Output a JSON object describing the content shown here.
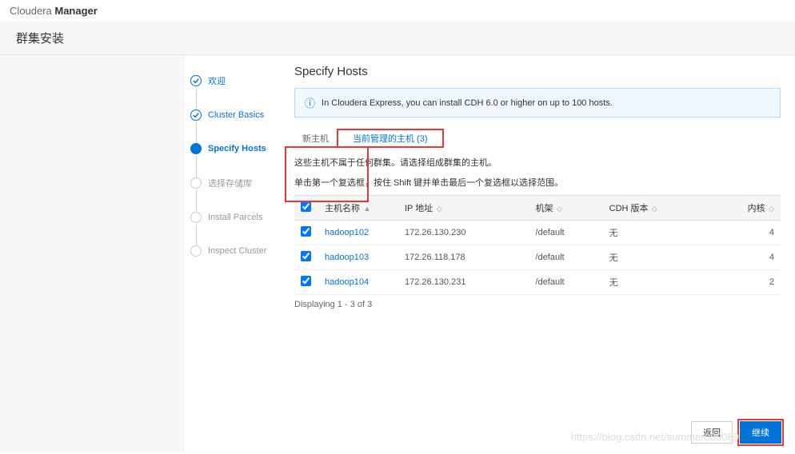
{
  "header": {
    "brand1": "Cloudera ",
    "brand2": "Manager"
  },
  "subheader": "群集安装",
  "wizard": {
    "steps": [
      "欢迎",
      "Cluster Basics",
      "Specify Hosts",
      "选择存储库",
      "Install Parcels",
      "Inspect Cluster"
    ]
  },
  "content": {
    "title": "Specify Hosts",
    "info": "In Cloudera Express, you can install CDH 6.0 or higher on up to 100 hosts.",
    "tabs": {
      "new_host": "新主机",
      "managed": "当前管理的主机 (3)"
    },
    "desc1": "这些主机不属于任何群集。请选择组成群集的主机。",
    "desc2": "单击第一个复选框，按住 Shift 键并单击最后一个复选框以选择范围。",
    "table": {
      "cols": {
        "name": "主机名称",
        "ip": "IP 地址",
        "rack": "机架",
        "cdh": "CDH 版本",
        "cores": "内核"
      },
      "rows": [
        {
          "checked": true,
          "name": "hadoop102",
          "ip": "172.26.130.230",
          "rack": "/default",
          "cdh": "无",
          "cores": "4"
        },
        {
          "checked": true,
          "name": "hadoop103",
          "ip": "172.26.118.178",
          "rack": "/default",
          "cdh": "无",
          "cores": "4"
        },
        {
          "checked": true,
          "name": "hadoop104",
          "ip": "172.26.130.231",
          "rack": "/default",
          "cdh": "无",
          "cores": "2"
        }
      ]
    },
    "pager": "Displaying 1 - 3 of 3"
  },
  "footer": {
    "back": "返回",
    "continue": "继续"
  },
  "watermark": "https://blog.csdn.net/summer089089"
}
